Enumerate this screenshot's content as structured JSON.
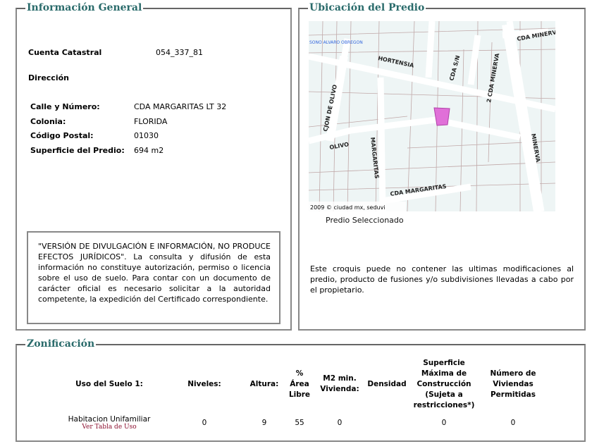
{
  "general": {
    "legend": "Información General",
    "cuenta_label": "Cuenta Catastral",
    "cuenta_value": "054_337_81",
    "direccion_label": "Dirección",
    "fields": [
      {
        "label": "Calle y Número:",
        "value": "CDA MARGARITAS LT 32"
      },
      {
        "label": "Colonia:",
        "value": "FLORIDA"
      },
      {
        "label": "Código Postal:",
        "value": "01030"
      },
      {
        "label": "Superficie del Predio:",
        "value": "694 m2"
      }
    ],
    "notice": "\"VERSIÓN DE DIVULGACIÓN E INFORMACIÓN, NO PRODUCE EFECTOS JURÍDICOS\". La consulta y difusión de esta información no constituye autorización, permiso o licencia sobre el uso de suelo. Para contar con un documento de carácter oficial es necesario solicitar a la autoridad competente, la expedición del Certificado correspondiente."
  },
  "ubicacion": {
    "legend": "Ubicación del Predio",
    "map_labels": {
      "delegacion": "SONO ALVARO OBREGON",
      "hortensia": "HORTENSIA",
      "cda_sn": "CDA S/N",
      "cda_minerva": "CDA MINERVA",
      "cda_minerva2": "2 CDA MINERVA",
      "cjon_olivo": "CJON DE OLIVO",
      "olivo": "OLIVO",
      "margaritas": "MARGARITAS",
      "minerva": "MINERVA",
      "cda_margaritas": "CDA MARGARITAS",
      "copyright": "2009 © ciudad mx, seduvi"
    },
    "caption": "Predio Seleccionado",
    "disclaimer": "Este croquis puede no contener las ultimas modificaciones al predio, producto de fusiones y/o subdivisiones llevadas a cabo por el propietario.",
    "highlight_color": "#e070d8"
  },
  "zonificacion": {
    "legend": "Zonificación",
    "headers": [
      "Uso del Suelo 1:",
      "Niveles:",
      "Altura:",
      "% Área Libre",
      "M2 min. Vivienda:",
      "Densidad",
      "Superficie Máxima de Construcción (Sujeta a restricciones*)",
      "Número de Viviendas Permitidas"
    ],
    "row": {
      "uso": "Habitacion Unifamiliar",
      "link": "Ver Tabla de Uso",
      "niveles": "0",
      "altura": "9",
      "area_libre": "55",
      "m2_min": "0",
      "densidad": "",
      "superficie": "0",
      "viviendas": "0"
    }
  }
}
